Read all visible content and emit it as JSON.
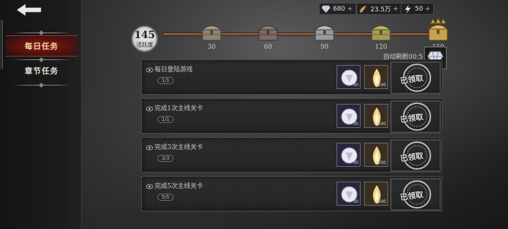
{
  "sidebar": {
    "tabs": [
      {
        "label": "每日任务",
        "active": true
      },
      {
        "label": "章节任务",
        "active": false
      }
    ]
  },
  "currencies": [
    {
      "icon": "diamond-icon",
      "value": "680",
      "plus": "+"
    },
    {
      "icon": "horn-icon",
      "value": "23.5万",
      "plus": "+"
    },
    {
      "icon": "lightning-icon",
      "value": "50",
      "plus": "+"
    }
  ],
  "activity": {
    "score": "145",
    "label": "活跃度",
    "progress_fraction": 1.0,
    "milestones": [
      "30",
      "60",
      "90",
      "120",
      "150"
    ],
    "auto_refresh": "自动刷新00:5"
  },
  "tasks": [
    {
      "title": "每日登陆游戏",
      "progress": "1/1",
      "rewards": [
        "30",
        "3500"
      ],
      "status": "已领取"
    },
    {
      "title": "完成1次主线关卡",
      "progress": "1/1",
      "rewards": [
        "30",
        "3500"
      ],
      "status": "已领取"
    },
    {
      "title": "完成3次主线关卡",
      "progress": "3/3",
      "rewards": [
        "30",
        "3500"
      ],
      "status": "已领取"
    },
    {
      "title": "完成5次主线关卡",
      "progress": "5/5",
      "rewards": [
        "30",
        "3500"
      ],
      "status": "已领取"
    }
  ],
  "colors": {
    "active_tab": "#8a1c14",
    "track": "#9a6e50",
    "gold": "#c8a24a"
  }
}
